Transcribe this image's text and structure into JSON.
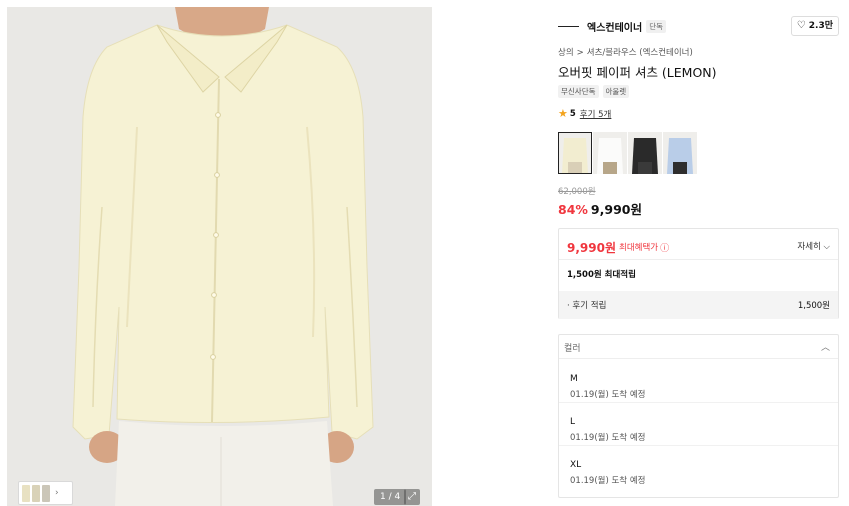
{
  "gallery": {
    "counter": "1 / 4",
    "expand_icon": "expand-icon",
    "thumbnail_chevron": "›",
    "product_color": "#f6f2d4"
  },
  "brand": {
    "name": "엑스컨테이너",
    "tag": "단독",
    "likes": "2.3만"
  },
  "breadcrumb": {
    "items": [
      "상의",
      "셔츠/블라우스 (엑스컨테이너)"
    ],
    "separator": ">"
  },
  "product": {
    "title": "오버핏 페이퍼 셔츠 (LEMON)",
    "tags": [
      "무신사단독",
      "아울렛"
    ],
    "rating": "5",
    "reviews": "후기 5개"
  },
  "swatches": {
    "colors": [
      "#f2edd0",
      "#f6f6f4",
      "#2a2a2a",
      "#b9cde8"
    ],
    "selected_index": 0
  },
  "price": {
    "original": "62,000원",
    "discount": "84%",
    "current": "9,990원"
  },
  "benefit": {
    "max_price": "9,990원",
    "max_label": "최대혜택가",
    "detail": "자세히",
    "points_label": "1,500원 최대적립",
    "review_label": "· 후기 적립",
    "review_value": "1,500원"
  },
  "options": {
    "header": "컬러",
    "items": [
      {
        "size": "M",
        "arrival": "01.19(월) 도착 예정"
      },
      {
        "size": "L",
        "arrival": "01.19(월) 도착 예정"
      },
      {
        "size": "XL",
        "arrival": "01.19(월) 도착 예정"
      }
    ]
  },
  "colors": {
    "accent": "#f0363e",
    "star": "#f3a31d"
  }
}
